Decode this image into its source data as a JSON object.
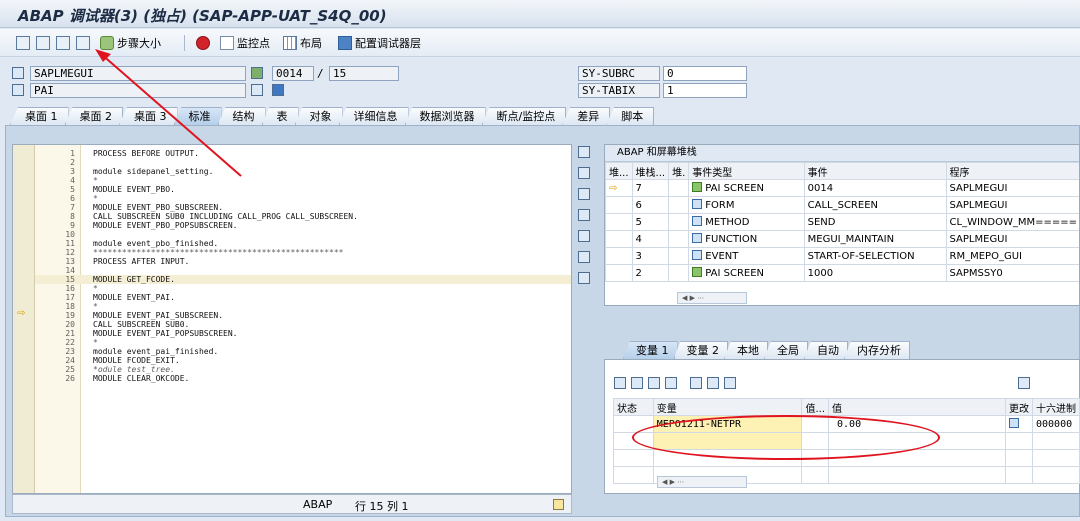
{
  "window": {
    "title": "ABAP 调试器(3) (独占) (SAP-APP-UAT_S4Q_00)"
  },
  "toolbar": {
    "step_size": "步骤大小",
    "watchpoint": "监控点",
    "layout": "布局",
    "config_debugger_layer": "配置调试器层"
  },
  "header": {
    "program": "SAPLMEGUI",
    "event": "PAI",
    "line_current": "0014",
    "line_sep": "/",
    "line_total": "15",
    "sysvar1_name": "SY-SUBRC",
    "sysvar1_value": "0",
    "sysvar2_name": "SY-TABIX",
    "sysvar2_value": "1"
  },
  "tabs": [
    "桌面 1",
    "桌面 2",
    "桌面 3",
    "标准",
    "结构",
    "表",
    "对象",
    "详细信息",
    "数据浏览器",
    "断点/监控点",
    "差异",
    "脚本"
  ],
  "code": [
    {
      "no": "1",
      "text": "PROCESS BEFORE OUTPUT."
    },
    {
      "no": "2",
      "text": ""
    },
    {
      "no": "3",
      "text": "module sidepanel_setting."
    },
    {
      "no": "4",
      "text": "*"
    },
    {
      "no": "5",
      "text": "MODULE EVENT_PBO."
    },
    {
      "no": "6",
      "text": "*"
    },
    {
      "no": "7",
      "text": "MODULE EVENT_PBO_SUBSCREEN."
    },
    {
      "no": "8",
      "text": "CALL SUBSCREEN SUB0 INCLUDING CALL_PROG CALL_SUBSCREEN."
    },
    {
      "no": "9",
      "text": "MODULE EVENT_PBO_POPSUBSCREEN."
    },
    {
      "no": "10",
      "text": ""
    },
    {
      "no": "11",
      "text": "module event_pbo_finished."
    },
    {
      "no": "12",
      "text": "****************************************************"
    },
    {
      "no": "13",
      "text": "PROCESS AFTER INPUT."
    },
    {
      "no": "14",
      "text": ""
    },
    {
      "no": "15",
      "text": "MODULE GET_FCODE."
    },
    {
      "no": "16",
      "text": "*"
    },
    {
      "no": "17",
      "text": "MODULE EVENT_PAI."
    },
    {
      "no": "18",
      "text": "*"
    },
    {
      "no": "19",
      "text": "MODULE EVENT_PAI_SUBSCREEN."
    },
    {
      "no": "20",
      "text": "CALL SUBSCREEN SUB0."
    },
    {
      "no": "21",
      "text": "MODULE EVENT_PAI_POPSUBSCREEN."
    },
    {
      "no": "22",
      "text": "*"
    },
    {
      "no": "23",
      "text": "module event_pai_finished."
    },
    {
      "no": "24",
      "text": "MODULE FCODE_EXIT."
    },
    {
      "no": "25",
      "text": "*odule test_tree."
    },
    {
      "no": "26",
      "text": "MODULE CLEAR_OKCODE."
    }
  ],
  "status": {
    "lang": "ABAP",
    "position": "行 15 列 1"
  },
  "stack": {
    "caption": "ABAP 和屏幕堆栈",
    "headers": [
      "堆...",
      "堆栈...",
      "堆.",
      "事件类型",
      "事件",
      "程序"
    ],
    "rows": [
      {
        "mark": "⇨",
        "depth": "7",
        "type": "PAI SCREEN",
        "event": "0014",
        "program": "SAPLMEGUI"
      },
      {
        "mark": "",
        "depth": "6",
        "type": "FORM",
        "event": "CALL_SCREEN",
        "program": "SAPLMEGUI"
      },
      {
        "mark": "",
        "depth": "5",
        "type": "METHOD",
        "event": "SEND",
        "program": "CL_WINDOW_MM====="
      },
      {
        "mark": "",
        "depth": "4",
        "type": "FUNCTION",
        "event": "MEGUI_MAINTAIN",
        "program": "SAPLMEGUI"
      },
      {
        "mark": "",
        "depth": "3",
        "type": "EVENT",
        "event": "START-OF-SELECTION",
        "program": "RM_MEPO_GUI"
      },
      {
        "mark": "",
        "depth": "2",
        "type": "PAI SCREEN",
        "event": "1000",
        "program": "SAPMSSY0"
      }
    ]
  },
  "vartabs": [
    "变量 1",
    "变量 2",
    "本地",
    "全局",
    "自动",
    "内存分析"
  ],
  "vars": {
    "headers": [
      "状态",
      "变量",
      "值...",
      "值",
      "更改",
      "十六进制"
    ],
    "row": {
      "name": "MEPO1211-NETPR",
      "value": "0.00",
      "hex": "000000"
    }
  },
  "colors": {
    "accent": "#e0141e",
    "tab_active": "#b6cfe9"
  }
}
